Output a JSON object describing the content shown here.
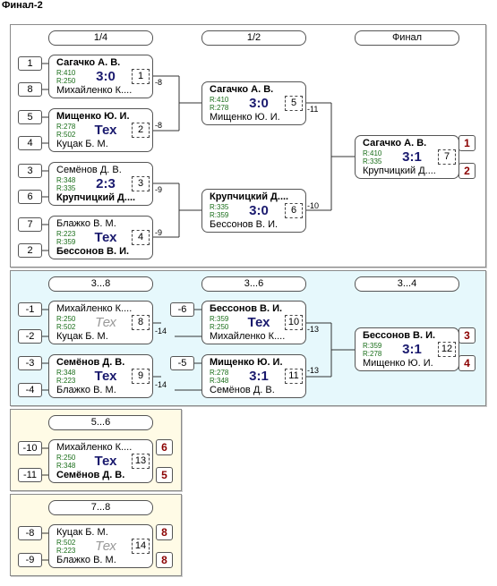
{
  "title": "Финал-2",
  "headers": {
    "r14": "1/4",
    "r12": "1/2",
    "final": "Финал",
    "c38": "3...8",
    "c36": "3...6",
    "c34": "3...4",
    "c56": "5...6",
    "c78": "7...8"
  },
  "seeds": {
    "s1": "1",
    "s8": "8",
    "s5": "5",
    "s4": "4",
    "s3": "3",
    "s6": "6",
    "s7": "7",
    "s2": "2",
    "m1": "-1",
    "m2": "-2",
    "m3": "-3",
    "m4": "-4",
    "m6": "-6",
    "m5": "-5",
    "m10": "-10",
    "m11": "-11",
    "m8": "-8",
    "m9": "-9"
  },
  "matches": {
    "q1": {
      "p1": "Сагачко А. В.",
      "r1": "R:410",
      "score": "3:0",
      "r2": "R:250",
      "p2": "Михайленко К....",
      "num": "1"
    },
    "q2": {
      "p1": "Мищенко Ю. И.",
      "r1": "R:278",
      "score": "Тех",
      "r2": "R:502",
      "p2": "Куцак Б. М.",
      "num": "2"
    },
    "q3": {
      "p1": "Семёнов Д. В.",
      "r1": "R:348",
      "score": "2:3",
      "r2": "R:335",
      "p2": "Крупчицкий Д....",
      "num": "3"
    },
    "q4": {
      "p1": "Блажко В. М.",
      "r1": "R:223",
      "score": "Тех",
      "r2": "R:359",
      "p2": "Бессонов В. И.",
      "num": "4"
    },
    "s1": {
      "p1": "Сагачко А. В.",
      "r1": "R:410",
      "score": "3:0",
      "r2": "R:278",
      "p2": "Мищенко Ю. И.",
      "num": "5"
    },
    "s2": {
      "p1": "Крупчицкий Д....",
      "r1": "R:335",
      "score": "3:0",
      "r2": "R:359",
      "p2": "Бессонов В. И.",
      "num": "6"
    },
    "f": {
      "p1": "Сагачко А. В.",
      "r1": "R:410",
      "score": "3:1",
      "r2": "R:335",
      "p2": "Крупчицкий Д....",
      "num": "7"
    },
    "c8": {
      "p1": "Михайленко К....",
      "r1": "R:250",
      "score": "Тех",
      "r2": "R:502",
      "p2": "Куцак Б. М.",
      "num": "8"
    },
    "c9": {
      "p1": "Семёнов Д. В.",
      "r1": "R:348",
      "score": "Тех",
      "r2": "R:223",
      "p2": "Блажко В. М.",
      "num": "9"
    },
    "c10": {
      "p1": "Бессонов В. И.",
      "r1": "R:359",
      "score": "Тех",
      "r2": "R:250",
      "p2": "Михайленко К....",
      "num": "10"
    },
    "c11": {
      "p1": "Мищенко Ю. И.",
      "r1": "R:278",
      "score": "3:1",
      "r2": "R:348",
      "p2": "Семёнов Д. В.",
      "num": "11"
    },
    "c12": {
      "p1": "Бессонов В. И.",
      "r1": "R:359",
      "score": "3:1",
      "r2": "R:278",
      "p2": "Мищенко Ю. И.",
      "num": "12"
    },
    "c13": {
      "p1": "Михайленко К....",
      "r1": "R:250",
      "score": "Тех",
      "r2": "R:348",
      "p2": "Семёнов Д. В.",
      "num": "13"
    },
    "c14": {
      "p1": "Куцак Б. М.",
      "r1": "R:502",
      "score": "Тех",
      "r2": "R:223",
      "p2": "Блажко В. М.",
      "num": "14"
    }
  },
  "connectors": {
    "q1": "-8",
    "q2": "-8",
    "q3": "-9",
    "q4": "-9",
    "s1": "-11",
    "s2": "-10",
    "c8": "-14",
    "c9": "-14",
    "c10": "-13",
    "c11": "-13"
  },
  "places": {
    "f1": "1",
    "f2": "2",
    "c12a": "3",
    "c12b": "4",
    "c13a": "6",
    "c13b": "5",
    "c14a": "8",
    "c14b": "8"
  },
  "colors": {
    "panel_main": "#ffffff",
    "panel_cons": "#e6f8fc",
    "panel_small": "#fffbe6",
    "rating": "#1a6e1a",
    "score": "#1a1a6e",
    "place": "#8b0000"
  }
}
